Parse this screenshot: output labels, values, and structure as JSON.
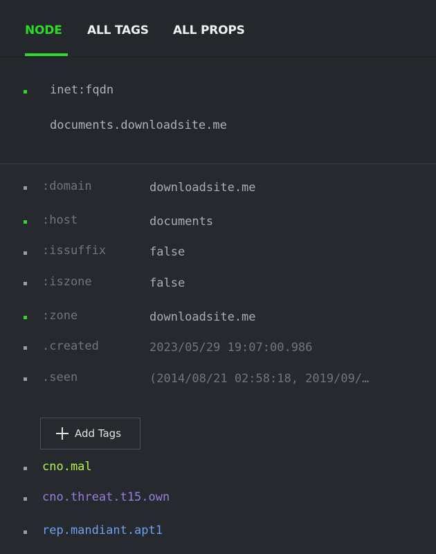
{
  "tabs": [
    {
      "label": "NODE",
      "active": true
    },
    {
      "label": "ALL TAGS",
      "active": false
    },
    {
      "label": "ALL PROPS",
      "active": false
    }
  ],
  "node": {
    "form": "inet:fqdn",
    "value": "documents.downloadsite.me"
  },
  "props": [
    {
      "name": ":domain",
      "value": "downloadsite.me",
      "bullet": "grey"
    },
    {
      "name": ":host",
      "value": "documents",
      "bullet": "green"
    },
    {
      "name": ":issuffix",
      "value": "false",
      "bullet": "grey"
    },
    {
      "name": ":iszone",
      "value": "false",
      "bullet": "grey"
    },
    {
      "name": ":zone",
      "value": "downloadsite.me",
      "bullet": "green"
    },
    {
      "name": ".created",
      "value": "2023/05/29 19:07:00.986",
      "bullet": "grey"
    },
    {
      "name": ".seen",
      "value": "(2014/08/21 02:58:18, 2019/09/…",
      "bullet": "grey"
    }
  ],
  "add_tags": {
    "label": "Add Tags",
    "icon": "plus-icon"
  },
  "tags": [
    {
      "name": "cno.mal",
      "color": "#b6f24a"
    },
    {
      "name": "cno.threat.t15.own",
      "color": "#9a7de0"
    },
    {
      "name": "rep.mandiant.apt1",
      "color": "#6ea0f0"
    }
  ],
  "colors": {
    "accent": "#2ed92a",
    "background": "#24282c"
  }
}
